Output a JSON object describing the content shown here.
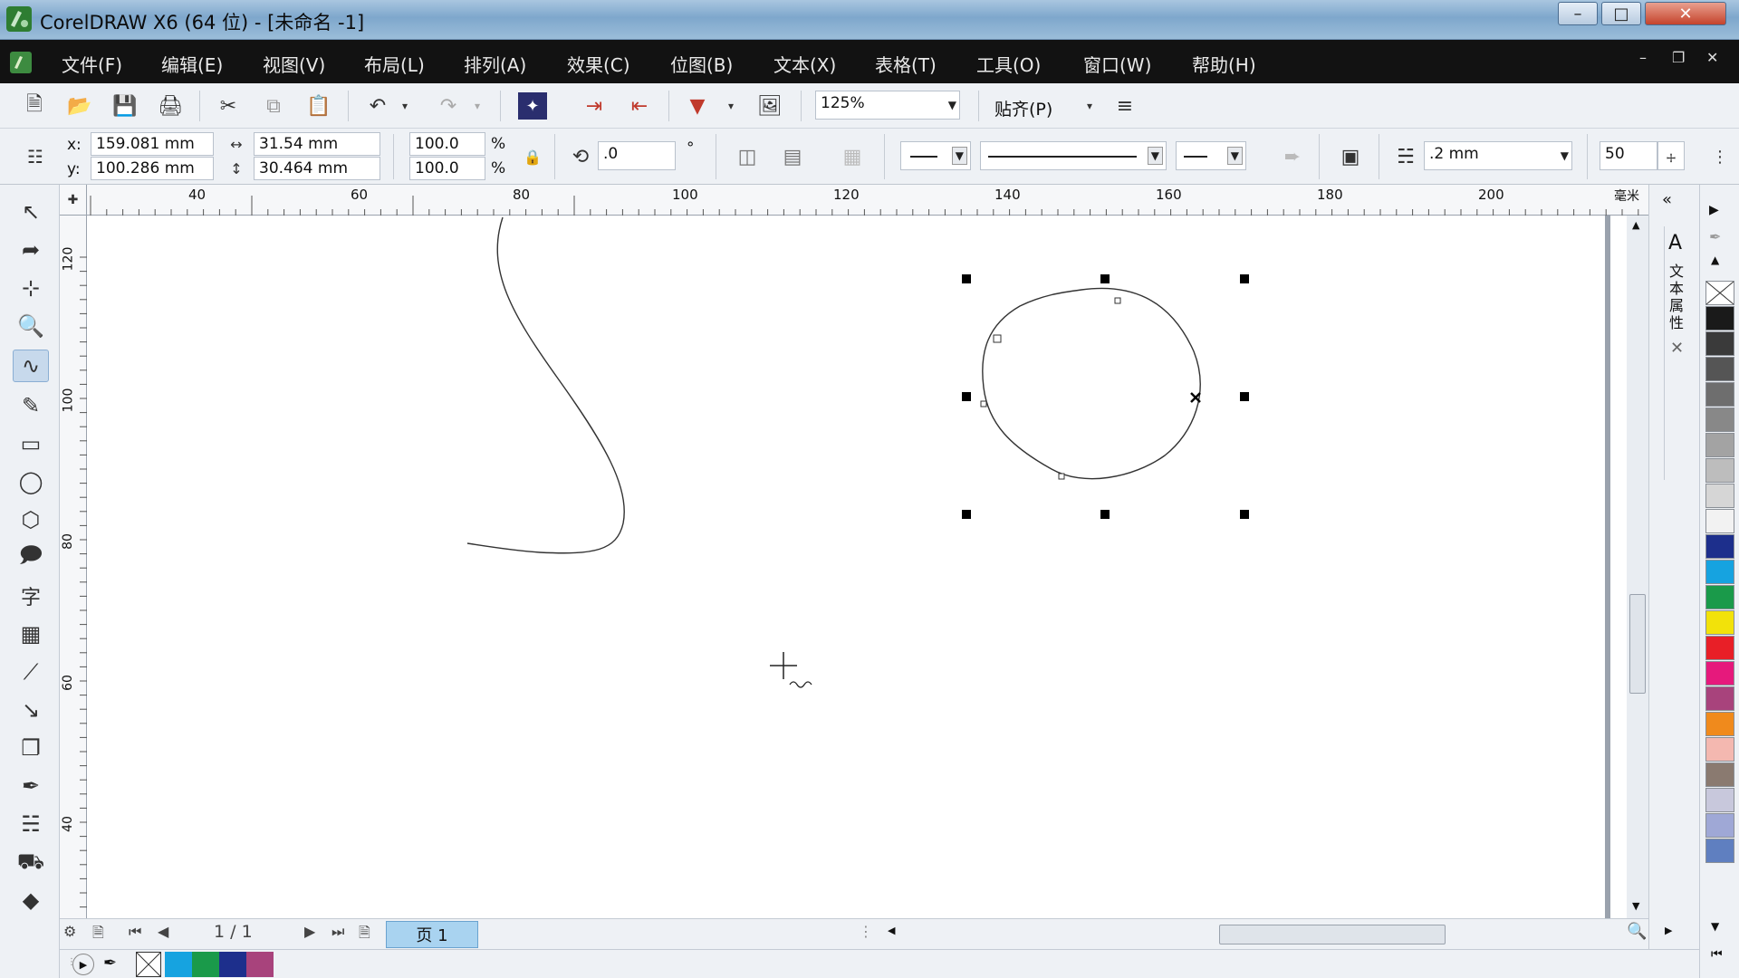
{
  "window": {
    "title": "CorelDRAW X6 (64 位) - [未命名 -1]",
    "minimize_icon": "minimize-icon",
    "maximize_icon": "maximize-icon",
    "close_icon": "close-icon"
  },
  "menu": {
    "items": [
      "文件(F)",
      "编辑(E)",
      "视图(V)",
      "布局(L)",
      "排列(A)",
      "效果(C)",
      "位图(B)",
      "文本(X)",
      "表格(T)",
      "工具(O)",
      "窗口(W)",
      "帮助(H)"
    ]
  },
  "standard_toolbar": {
    "zoom_value": "125%",
    "snap_label": "贴齐(P)"
  },
  "property_bar": {
    "x_label": "x:",
    "x_value": "159.081 mm",
    "y_label": "y:",
    "y_value": "100.286 mm",
    "width_value": "31.54 mm",
    "height_value": "30.464 mm",
    "scale_x": "100.0",
    "scale_y": "100.0",
    "percent": "%",
    "rotation_value": ".0",
    "degree": "°",
    "outline_width": ".2 mm",
    "smoothing_value": "50"
  },
  "rulers": {
    "unit": "毫米",
    "h_ticks": [
      "40",
      "60",
      "80",
      "100",
      "120",
      "140",
      "160",
      "180",
      "200"
    ],
    "v_ticks": [
      "120",
      "100",
      "80",
      "60",
      "40"
    ]
  },
  "navigation": {
    "page_count": "1 / 1",
    "page_tab": "页 1"
  },
  "docker": {
    "title": "文本属性"
  },
  "palette": {
    "colors": [
      "#1a1a1a",
      "#3a3a3a",
      "#555555",
      "#6e6e6e",
      "#888888",
      "#a3a3a3",
      "#bdbdbd",
      "#d6d6d6",
      "#f2f2f2",
      "#1d2f8c",
      "#16a3e0",
      "#1a9a4a",
      "#f2e20a",
      "#e81f27",
      "#e6197c",
      "#a8437c",
      "#f08a1c",
      "#f4b8b0",
      "#8a7a70",
      "#c8c8dc",
      "#9fa8d6",
      "#5f7fc0"
    ]
  },
  "status_palette": {
    "colors": [
      "#16a3e0",
      "#1a9a4a",
      "#1d2f8c",
      "#a8437c"
    ]
  }
}
